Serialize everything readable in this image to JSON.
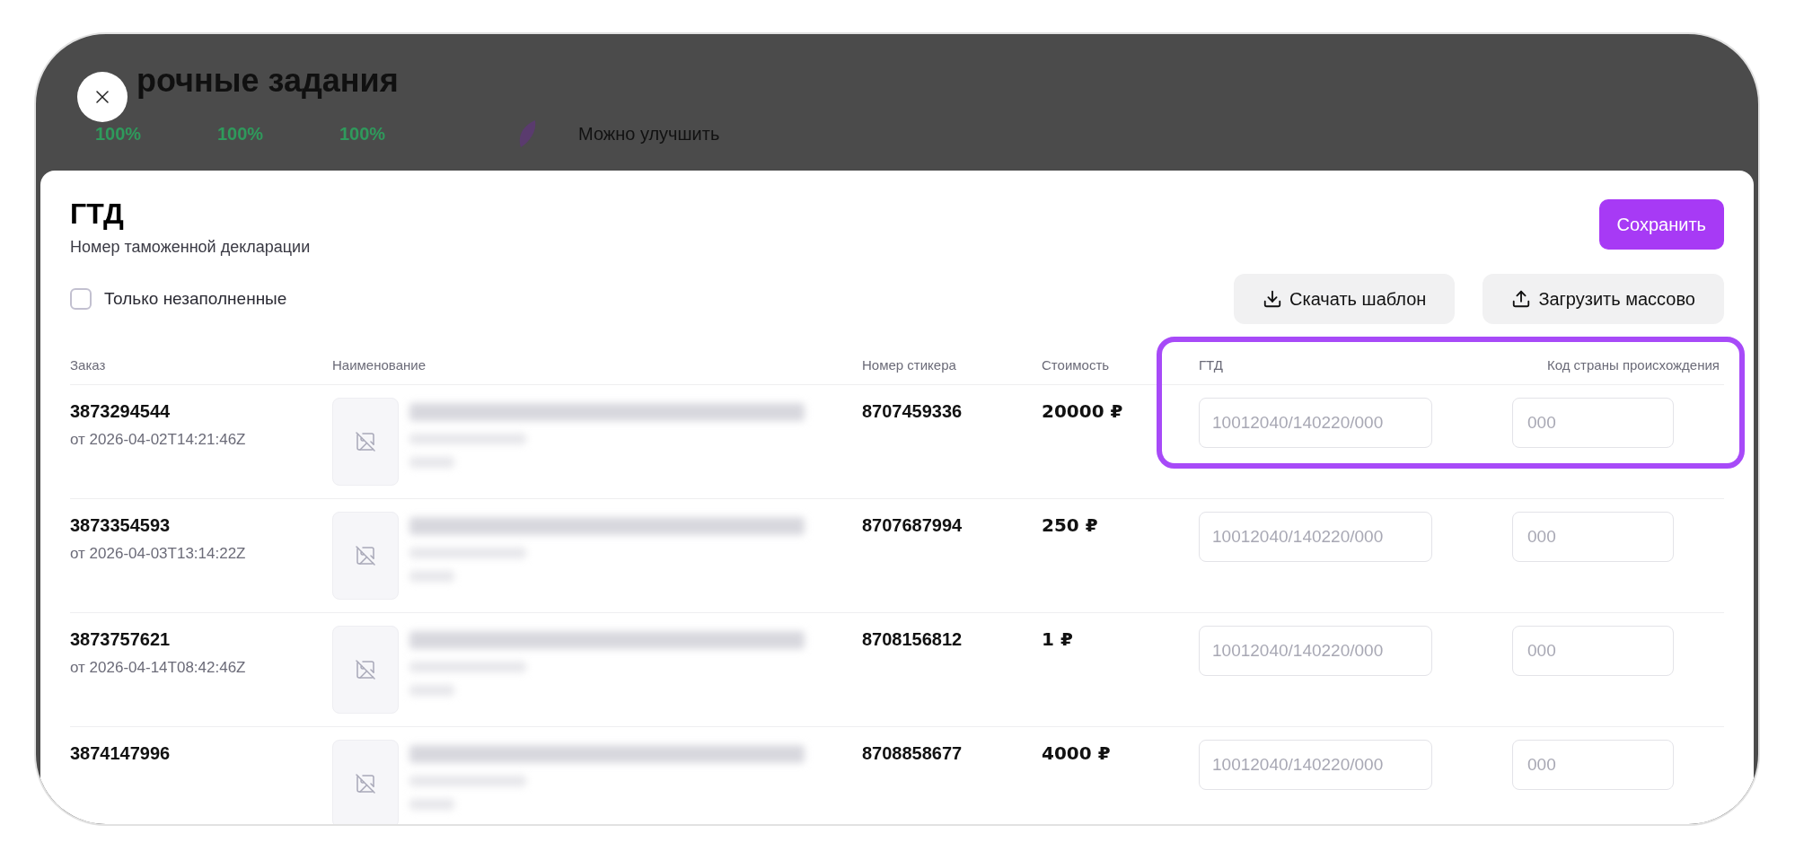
{
  "background": {
    "title": "рочные задания",
    "stats": [
      "100%",
      "100%",
      "100%"
    ],
    "notice": "Можно улучшить"
  },
  "modal": {
    "title": "ГТД",
    "subtitle": "Номер таможенной декларации",
    "save_button": "Сохранить",
    "filter": {
      "label": "Только незаполненные",
      "checked": false
    },
    "actions": [
      {
        "label": "Скачать шаблон",
        "kind": "download"
      },
      {
        "label": "Загрузить массово",
        "kind": "upload"
      }
    ]
  },
  "table": {
    "columns": [
      "Заказ",
      "Наименование",
      "Номер стикера",
      "Стоимость",
      "ГТД",
      "Код страны происхождения"
    ],
    "highlight_last_columns": true,
    "rows": [
      {
        "order": "3873294544",
        "date": "от 2026-04-02T14:21:46Z",
        "sticker": "8707459336",
        "price": "20000 ₽",
        "gtd_placeholder": "10012040/140220/000",
        "country_placeholder": "000"
      },
      {
        "order": "3873354593",
        "date": "от 2026-04-03T13:14:22Z",
        "sticker": "8707687994",
        "price": "250 ₽",
        "gtd_placeholder": "10012040/140220/000",
        "country_placeholder": "000"
      },
      {
        "order": "3873757621",
        "date": "от 2026-04-14T08:42:46Z",
        "sticker": "8708156812",
        "price": "1 ₽",
        "gtd_placeholder": "10012040/140220/000",
        "country_placeholder": "000"
      },
      {
        "order": "3874147996",
        "sticker": "8708858677",
        "price": "4000 ₽",
        "gtd_placeholder": "10012040/140220/000",
        "country_placeholder": "000"
      }
    ]
  }
}
